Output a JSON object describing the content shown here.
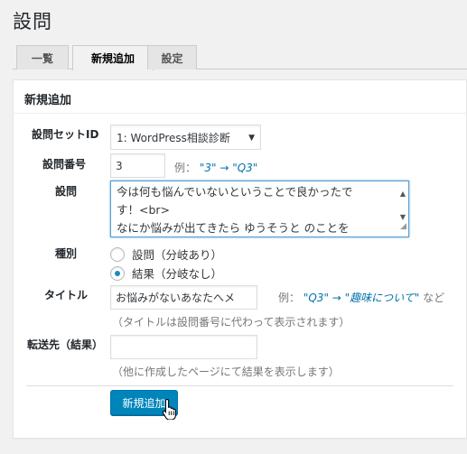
{
  "page": {
    "title": "設問"
  },
  "tabs": [
    {
      "label": "一覧",
      "active": false
    },
    {
      "label": "新規追加",
      "active": true
    },
    {
      "label": "設定",
      "active": false
    }
  ],
  "form": {
    "title": "新規追加",
    "set_id": {
      "label": "設問セットID",
      "selected": "1: WordPress相談診断"
    },
    "number": {
      "label": "設問番号",
      "value": "3",
      "hint_prefix": "例：",
      "hint_example": "\"3\" → \"Q3\""
    },
    "question": {
      "label": "設問",
      "lines": [
        "今は何も悩んでいないということで良かったで",
        "す！<br>",
        "なにか悩みが出てきたら ゆうそうと のことを"
      ]
    },
    "type": {
      "label": "種別",
      "options": [
        {
          "label": "設問（分岐あり）",
          "checked": false
        },
        {
          "label": "結果（分岐なし）",
          "checked": true
        }
      ]
    },
    "title_field": {
      "label": "タイトル",
      "value": "お悩みがないあなたへメ",
      "hint_prefix": "例：",
      "hint_example": "\"Q3\" → \"趣味について\"",
      "hint_suffix": "など",
      "note": "（タイトルは設問番号に代わって表示されます）"
    },
    "redirect": {
      "label": "転送先（結果）",
      "value": "",
      "note": "（他に作成したページにて結果を表示します）"
    },
    "submit_label": "新規追加"
  },
  "colors": {
    "primary": "#0085ba",
    "focus_border": "#5b9dd9",
    "hint_blue": "#0073aa"
  }
}
